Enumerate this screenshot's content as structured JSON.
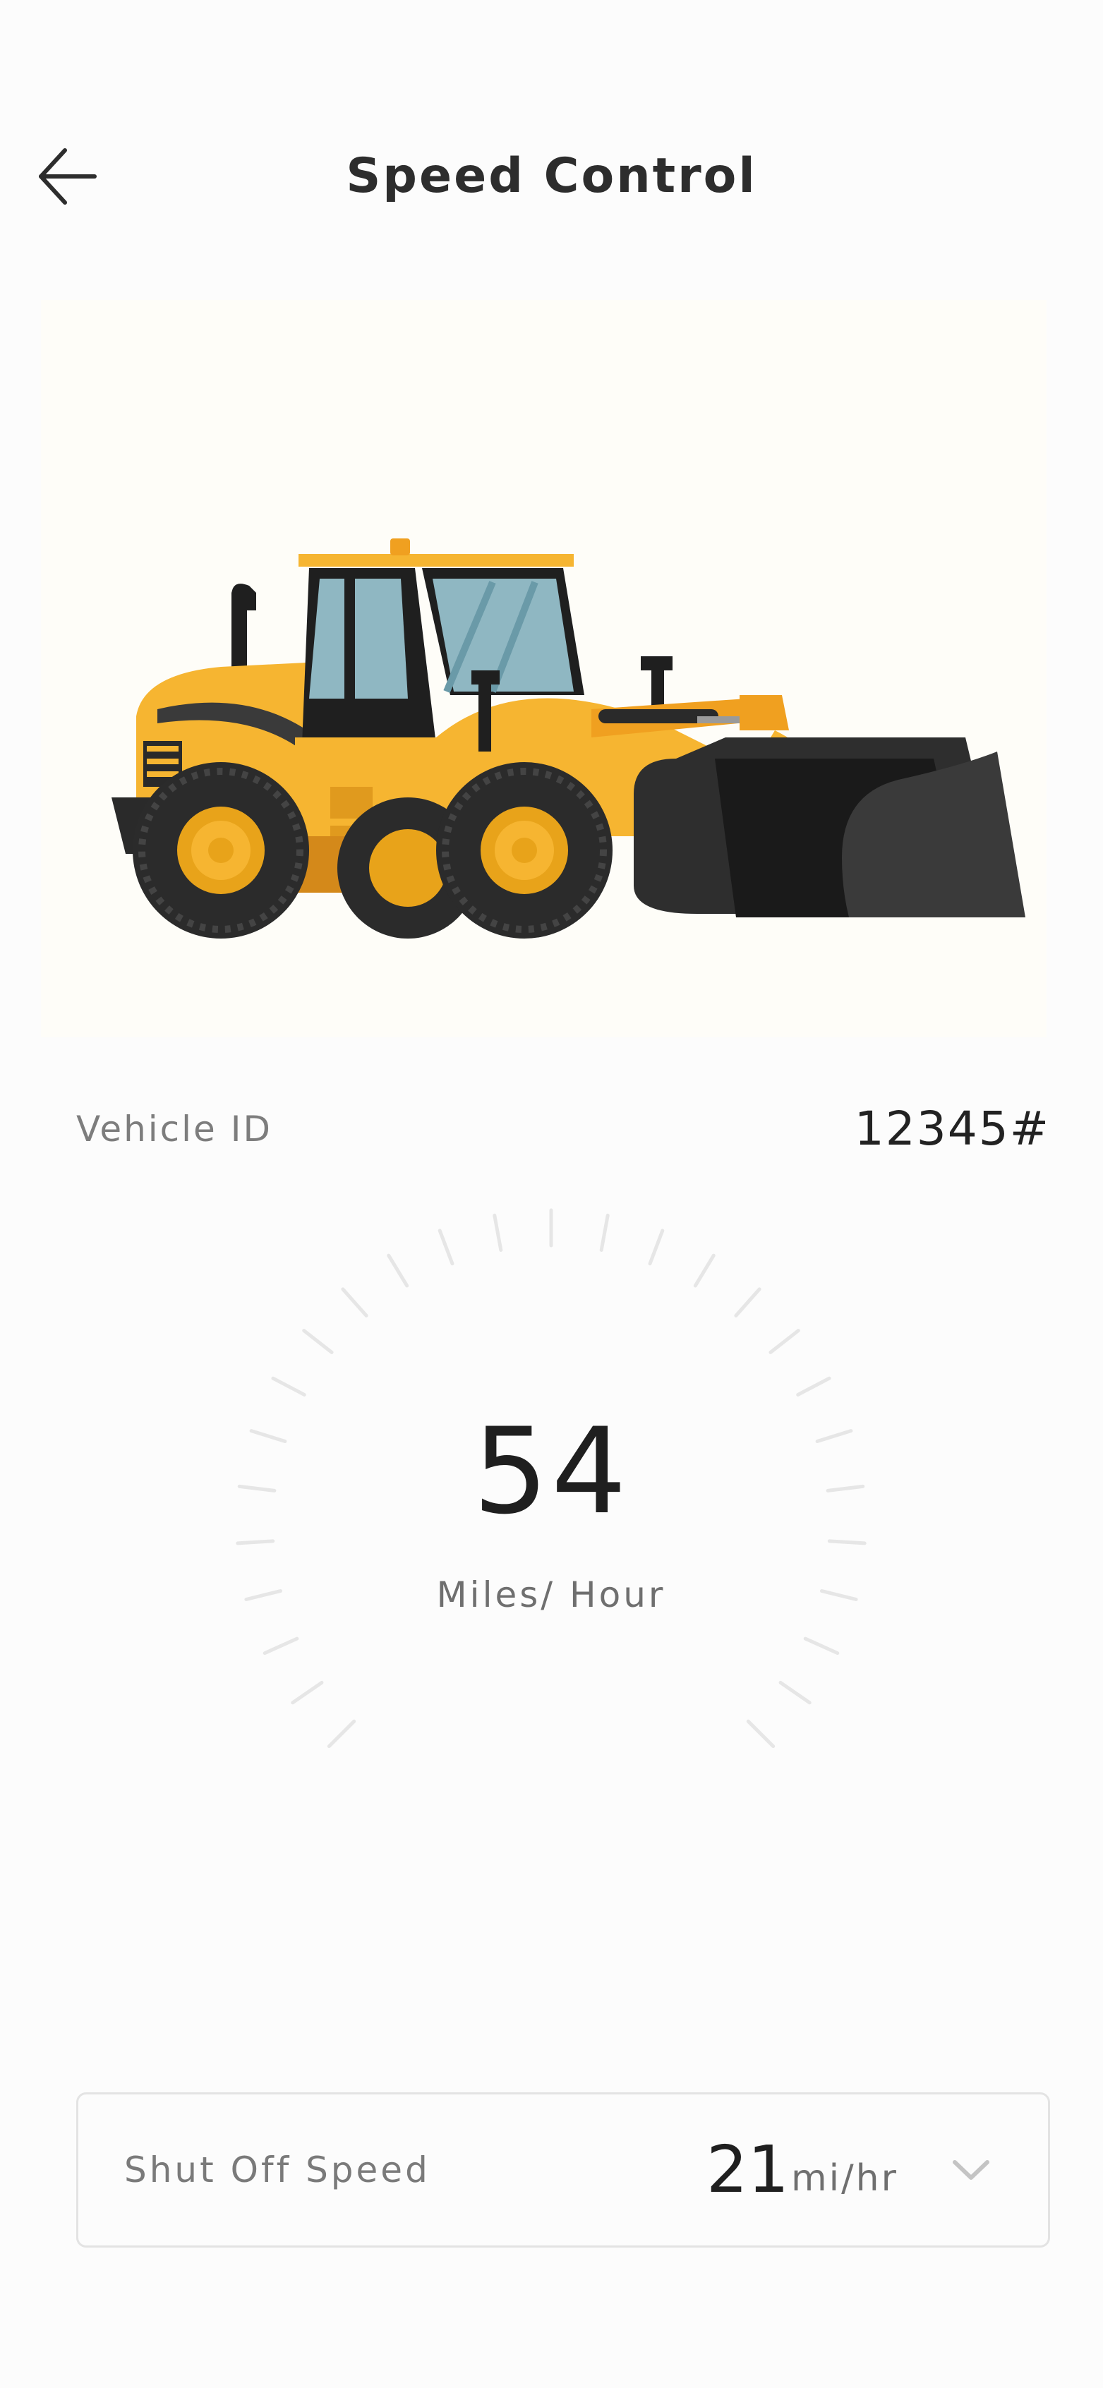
{
  "header": {
    "title": "Speed Control",
    "back_icon": "arrow-left-icon"
  },
  "hero": {
    "image": "wheel-loader-illustration"
  },
  "vehicle": {
    "label": "Vehicle ID",
    "value": "12345#"
  },
  "speedometer": {
    "value": "54",
    "unit": "Miles/ Hour"
  },
  "shutoff": {
    "label": "Shut Off Speed",
    "value": "21",
    "unit": "mi/hr",
    "icon": "chevron-down-icon"
  },
  "colors": {
    "background": "#fcfcfc",
    "text_primary": "#2b2b2b",
    "text_secondary": "#7a7a7a",
    "loader_yellow": "#f6b531",
    "loader_dark": "#2e2e2e",
    "hero_bg": "#fefdf8"
  }
}
